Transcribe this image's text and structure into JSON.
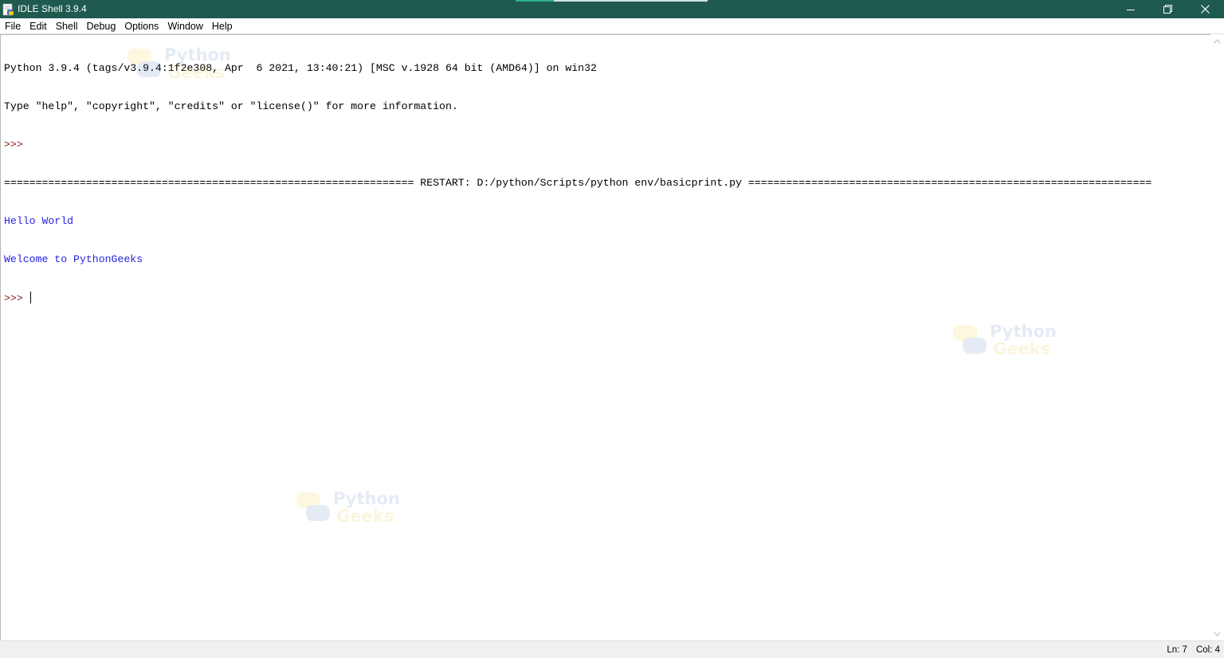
{
  "window": {
    "title": "IDLE Shell 3.9.4",
    "controls": {
      "minimize": "—",
      "restore": "❐",
      "close": "✕"
    }
  },
  "menu": [
    "File",
    "Edit",
    "Shell",
    "Debug",
    "Options",
    "Window",
    "Help"
  ],
  "shell": {
    "lines": [
      {
        "kind": "normal",
        "text": "Python 3.9.4 (tags/v3.9.4:1f2e308, Apr  6 2021, 13:40:21) [MSC v.1928 64 bit (AMD64)] on win32"
      },
      {
        "kind": "normal",
        "text": "Type \"help\", \"copyright\", \"credits\" or \"license()\" for more information."
      },
      {
        "kind": "prompt",
        "text": ">>> "
      },
      {
        "kind": "normal",
        "text": "================================================================= RESTART: D:/python/Scripts/python env/basicprint.py ================================================================"
      },
      {
        "kind": "out",
        "text": "Hello World"
      },
      {
        "kind": "out",
        "text": "Welcome to PythonGeeks"
      },
      {
        "kind": "prompt",
        "text": ">>> "
      }
    ]
  },
  "status": {
    "line": "Ln: 7",
    "col": "Col: 4"
  },
  "watermark": {
    "top": "Python",
    "bottom": "Geeks"
  },
  "colors": {
    "titlebar": "#1f5a4e",
    "prompt": "#8b1a1a",
    "output": "#2323e0"
  }
}
